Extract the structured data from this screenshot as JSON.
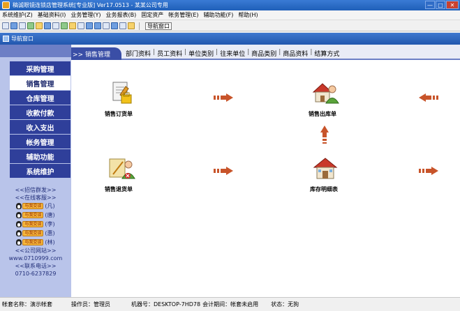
{
  "window": {
    "title": "稿诚眼镜连锁店管理系统[专业版] Ver17.0513 - 某某公司专用",
    "min": "—",
    "max": "□",
    "close": "✕"
  },
  "menu": [
    "系统维护(Z)",
    "基础资料(I)",
    "业务管理(Y)",
    "业务报表(B)",
    "固定资产",
    "帐务管理(E)",
    "辅助功能(F)",
    "帮助(H)"
  ],
  "toolbar": {
    "nav_window_button": "导航窗口"
  },
  "nav_window": {
    "title": "导航窗口"
  },
  "sidebar": {
    "items": [
      "采购管理",
      "销售管理",
      "仓库管理",
      "收款付款",
      "收入支出",
      "帐务管理",
      "辅助功能",
      "系统维护"
    ],
    "active_index": 1,
    "recruit": "<<招信群发>>",
    "online_service": "<<在线客服>>",
    "qq_label": "与我交谈",
    "qq_contacts": [
      "(凡)",
      "(唐)",
      "(李)",
      "(惠)",
      "(林)"
    ],
    "website_title": "<<公司网站>>",
    "website": "www.0710999.com",
    "phone_title": "<<联系电话>>",
    "phone": "0710-6237829"
  },
  "main": {
    "active_tab": ">> 销售管理",
    "tabs": [
      "部门资料",
      "员工资料",
      "单位类别",
      "往来单位",
      "商品类别",
      "商品资料",
      "结算方式"
    ],
    "tab_separator": "|",
    "flow": {
      "sales_order": "销售订货单",
      "sales_outbound": "销售出库单",
      "sales_return": "销售退货单",
      "inventory_detail": "库存明细表"
    }
  },
  "status": {
    "account_label": "帐套名称：",
    "account": "演示帐套",
    "operator_label": "操作员：",
    "operator": "管理员",
    "machine_label": "机器号：",
    "machine": "DESKTOP-7HD78",
    "period_label": "会计期间：",
    "period": "帐套未启用",
    "state_label": "状态：",
    "state": "无狗"
  },
  "colors": {
    "sidebar_button": "#2f3f9a",
    "sidebar_bg": "#b9c4ea",
    "arrow": "#c8542a"
  }
}
